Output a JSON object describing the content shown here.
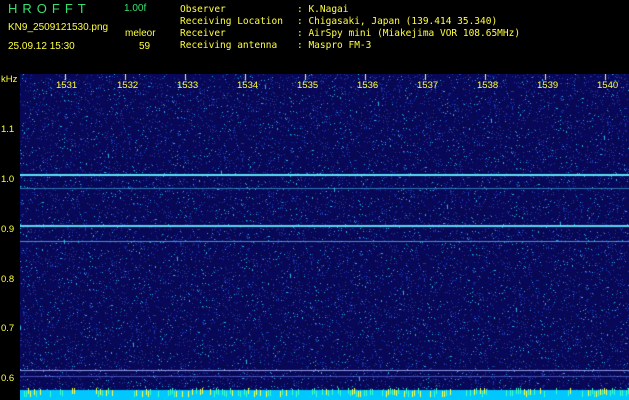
{
  "header": {
    "app_title": "HROFFT",
    "version": "1.00f",
    "filename": "KN9_2509121530.png",
    "datetime": "25.09.12 15:30",
    "meleor_label": "meleor",
    "meleor_value": "59"
  },
  "info": [
    {
      "key": "Observer",
      "value": ": K.Nagai"
    },
    {
      "key": "Receiving Location",
      "value": ": Chigasaki, Japan (139.414 35.340)"
    },
    {
      "key": "Receiver",
      "value": ": AirSpy mini (Miakejima VOR 108.65MHz)"
    },
    {
      "key": "Receiving antenna",
      "value": ": Maspro FM-3"
    }
  ],
  "y_axis": {
    "unit": "kHz",
    "ticks": [
      "1.1",
      "1.0",
      "0.9",
      "0.8",
      "0.7",
      "0.6"
    ]
  },
  "x_axis": {
    "ticks": [
      "1531",
      "1532",
      "1533",
      "1534",
      "1535",
      "1536",
      "1537",
      "1538",
      "1539",
      "1540"
    ]
  },
  "colors": {
    "background": "#000000",
    "waterfall_base": "#0a0a5a",
    "signal_cyan": "#5ff0ff",
    "label_yellow": "#ffff40",
    "title_green": "#38e070"
  }
}
